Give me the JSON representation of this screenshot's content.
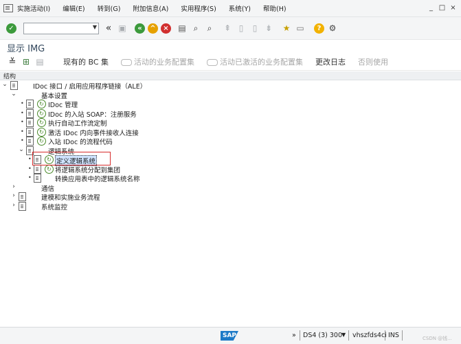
{
  "menubar": {
    "items": [
      "实施活动(I)",
      "编辑(E)",
      "转到(G)",
      "附加信息(A)",
      "实用程序(S)",
      "系统(Y)",
      "帮助(H)"
    ],
    "window_controls": [
      "_",
      "□",
      "×"
    ]
  },
  "toolbar": {
    "command_field_value": "",
    "icons": [
      "check-icon",
      "back-icon",
      "exit-icon",
      "cancel-icon",
      "print-icon",
      "find-icon",
      "find-next-icon",
      "first-page-icon",
      "prev-page-icon",
      "next-page-icon",
      "last-page-icon",
      "new-session-icon",
      "shortcut-icon",
      "help-icon",
      "settings-icon"
    ]
  },
  "screen": {
    "title": "显示 IMG"
  },
  "app_toolbar": {
    "current_bc_set": "现有的 BC 集",
    "active_bc_set": "活动的业务配置集",
    "activated_bc_set": "活动已激活的业务配置集",
    "change_log": "更改日志",
    "is_used": "否则使用"
  },
  "structure": {
    "header": "结构"
  },
  "tree": {
    "root": "IDoc 接口 / 启用应用程序链接（ALE）",
    "basic_settings": "基本设置",
    "idoc_admin": "IDoc 管理",
    "idoc_soap": "IDoc 的入站 SOAP：注册服务",
    "workflow": "执行自动工作流定制",
    "activate_receiver": "激活 IDoc 内向事件接收人连接",
    "inbound_process": "入站 IDoc 的流程代码",
    "logical_systems": "逻辑系统",
    "define_ls": "定义逻辑系统",
    "assign_ls": "将逻辑系统分配到集团",
    "convert_ls": "转换应用表中的逻辑系统名称",
    "communication": "通信",
    "modelling": "建模和实施业务流程",
    "monitoring": "系统监控"
  },
  "status": {
    "logo": "SAP",
    "arrow": "»",
    "system": "DS4 (3) 300",
    "server": "vhszfds4ci",
    "mode": "INS",
    "watermark": "CSDN @钱..."
  }
}
